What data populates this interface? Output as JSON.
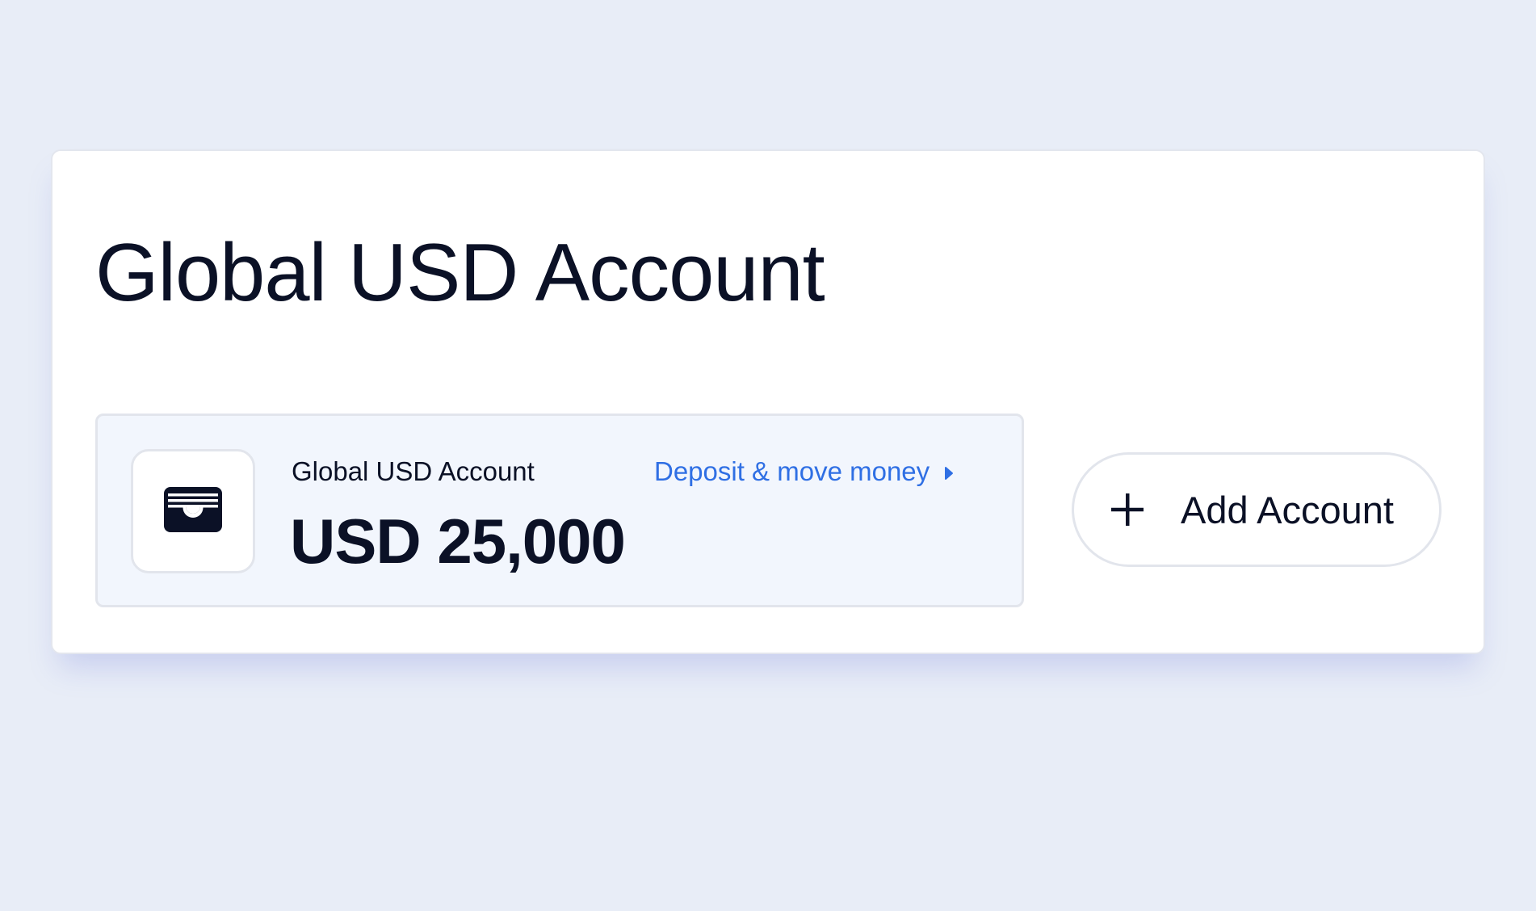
{
  "page": {
    "title": "Global USD Account"
  },
  "account_card": {
    "icon": "wallet-icon",
    "name": "Global USD Account",
    "balance": "USD 25,000",
    "action_label": "Deposit & move money",
    "action_icon": "caret-right-icon"
  },
  "add_account": {
    "icon": "plus-icon",
    "label": "Add Account"
  },
  "colors": {
    "background": "#e8edf7",
    "panel": "#ffffff",
    "card": "#f2f6fd",
    "text": "#0b1126",
    "link": "#2f6fe4",
    "border": "#e2e5ec"
  }
}
